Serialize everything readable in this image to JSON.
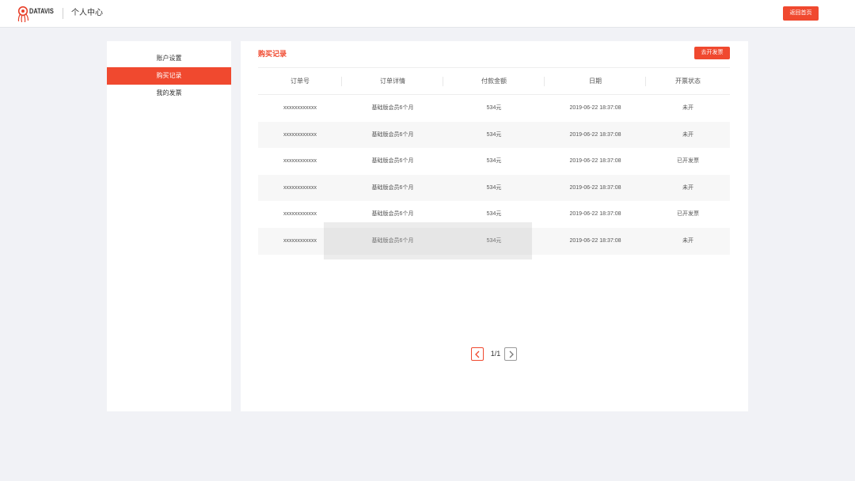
{
  "header": {
    "logo_text": "DATAVIS",
    "logo_icon": "octopus-logo-icon",
    "title": "个人中心",
    "back_label": "返回首页"
  },
  "sidebar": {
    "items": [
      {
        "label": "账户设置",
        "active": false
      },
      {
        "label": "购买记录",
        "active": true
      },
      {
        "label": "我的发票",
        "active": false
      }
    ]
  },
  "main": {
    "title": "购买记录",
    "invoice_label": "去开发票",
    "table": {
      "columns": [
        "订单号",
        "订单详情",
        "付款金额",
        "日期",
        "开票状态"
      ],
      "rows": [
        [
          "xxxxxxxxxxxx",
          "基础版会员6个月",
          "534元",
          "2019-06-22 18:37:08",
          "未开"
        ],
        [
          "xxxxxxxxxxxx",
          "基础版会员6个月",
          "534元",
          "2019-06-22 18:37:08",
          "未开"
        ],
        [
          "xxxxxxxxxxxx",
          "基础版会员6个月",
          "534元",
          "2019-06-22 18:37:08",
          "已开发票"
        ],
        [
          "xxxxxxxxxxxx",
          "基础版会员6个月",
          "534元",
          "2019-06-22 18:37:08",
          "未开"
        ],
        [
          "xxxxxxxxxxxx",
          "基础版会员6个月",
          "534元",
          "2019-06-22 18:37:08",
          "已开发票"
        ],
        [
          "xxxxxxxxxxxx",
          "基础版会员6个月",
          "534元",
          "2019-06-22 18:37:08",
          "未开"
        ]
      ]
    }
  },
  "pagination": {
    "page_text": "1/1",
    "prev_icon": "chevron-left-icon",
    "next_icon": "chevron-right-icon"
  },
  "colors": {
    "accent": "#f0492f",
    "page_background": "#f1f2f6",
    "row_stripe": "#f7f7f7"
  }
}
